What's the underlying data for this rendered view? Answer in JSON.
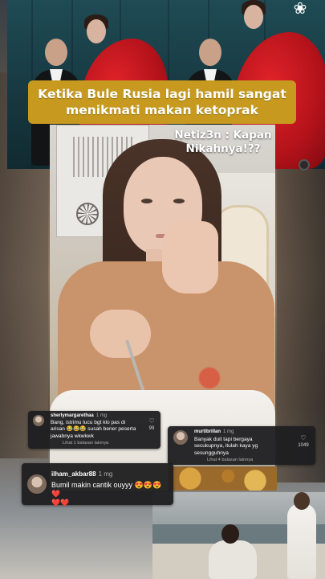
{
  "headline": {
    "line1": "Ketika Bule Rusia lagi hamil sangat",
    "line2": "menikmati makan ketoprak"
  },
  "overlay": {
    "line1": "Netiz3n : Kapan",
    "line2": "Nikahnya!??"
  },
  "corner_icon": {
    "name": "flower-icon",
    "glyph": "❀"
  },
  "comments": [
    {
      "user": "sherlymargarethaa",
      "time": "1 mg",
      "text_line1": "Bang, istrimu lucu bgt klo pas di",
      "text_line2": "arisan 😂😂😂 susah bener peserta",
      "text_line3": "jawabnya wkwkwk",
      "replies": "Lihat 1 balasan lainnya",
      "likes": "99"
    },
    {
      "user": "murtibrillan",
      "time": "1 mg",
      "text_line1": "Banyak duit tapi bergaya",
      "text_line2": "secukupnya, itulah kaya yg",
      "text_line3": "sesungguhnya",
      "replies": "Lihat 4 balasan lainnya",
      "likes": "1049"
    },
    {
      "user": "ilham_akbar88",
      "time": "1 mg",
      "text_line1": "Bumil makin cantik ouyyy 😍😍😍❤️",
      "text_line2": "❤️❤️"
    }
  ],
  "colors": {
    "headline_bg": "#c79a1f",
    "comment_bg": "#1e1e20",
    "dress_red": "#c8141c"
  }
}
